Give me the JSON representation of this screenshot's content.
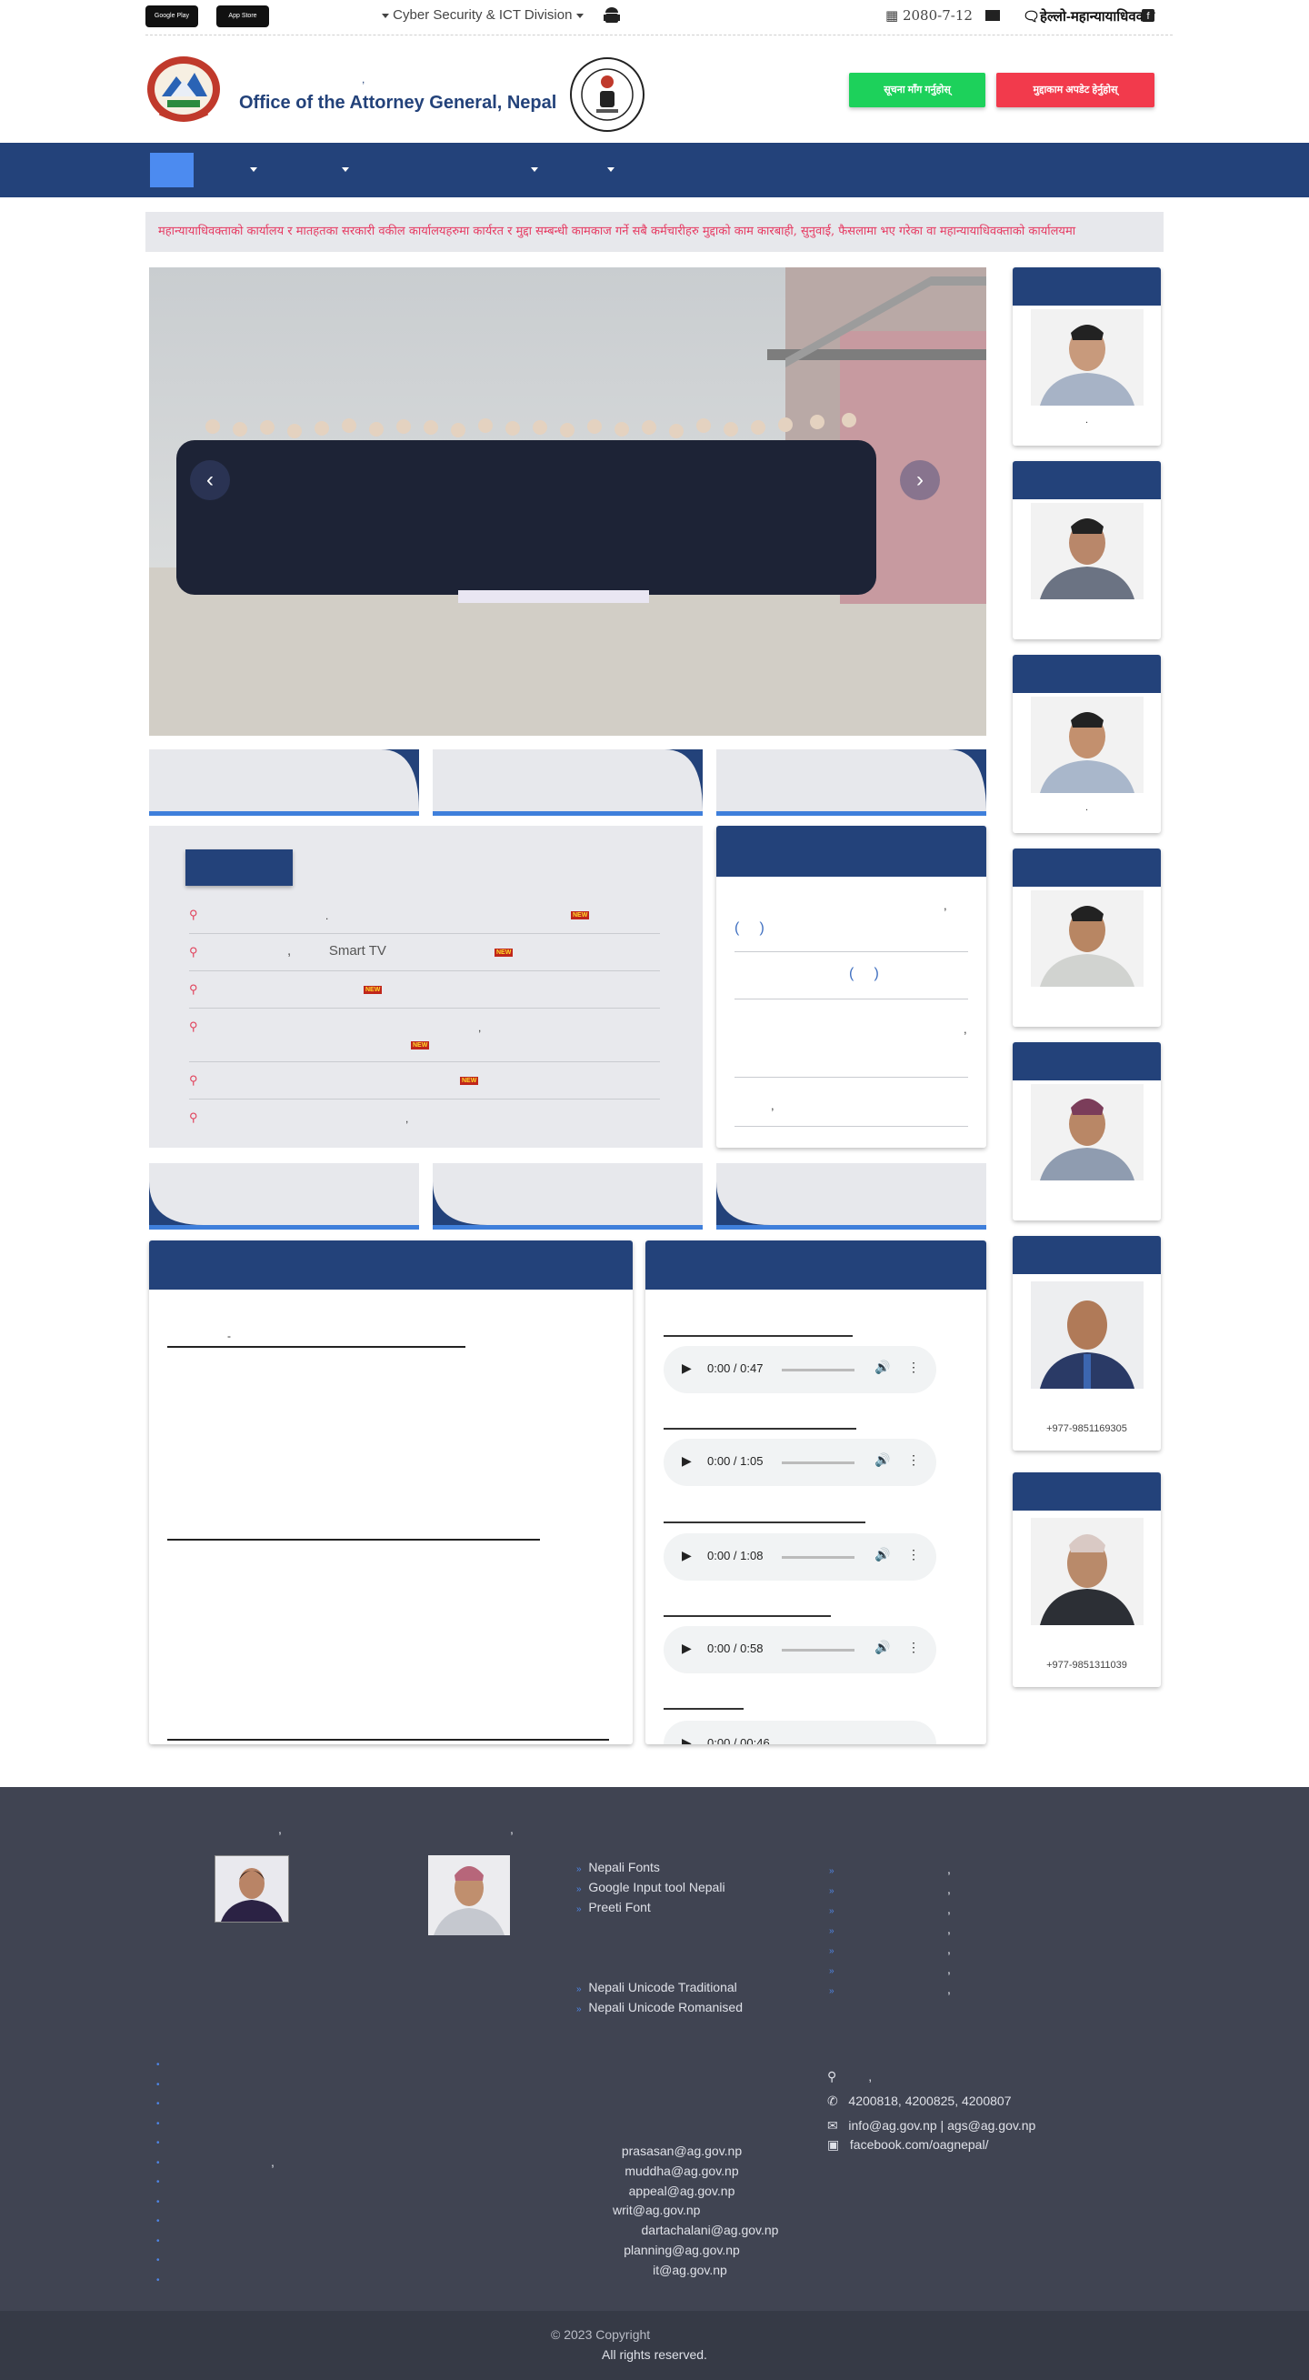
{
  "topbar": {
    "google_play": "Google Play",
    "app_store": "App Store",
    "division_dropdown": "Cyber Security & ICT Division",
    "date": "2080-7-12",
    "hotline": "हेल्लो-महान्यायाधिवक्ता"
  },
  "header": {
    "title_small": ",",
    "title_en": "Office of the Attorney General, Nepal",
    "btn_green": "सूचना माँग गर्नुहोस्",
    "btn_red": "मुद्दाकाम अपडेट हेर्नुहोस्"
  },
  "ticker": "महान्यायाधिवक्ताको कार्यालय र मातहतका सरकारी वकील कार्यालयहरुमा कार्यरत र मुद्दा सम्बन्धी कामकाज गर्ने सबै कर्मचारीहरु मुद्दाको काम कारबाही, सुनुवाई, फैसलामा भए गरेका वा महान्यायाधिवक्ताको कार्यालयमा",
  "news": [
    {
      "text": ".",
      "new": "NEW"
    },
    {
      "text": ",          Smart TV",
      "new": "NEW"
    },
    {
      "text": "",
      "new": "NEW"
    },
    {
      "text": ",",
      "new": "NEW"
    },
    {
      "text": "",
      "new": "NEW"
    },
    {
      "text": ",",
      "new": ""
    }
  ],
  "notice": {
    "row1": ",",
    "row1b": "(     )",
    "row2": "(     )",
    "row3": ",",
    "row4": ","
  },
  "left_panel": {
    "row1_dash": "-"
  },
  "audio": [
    {
      "time": "0:00 / 0:47"
    },
    {
      "time": "0:00 / 1:05"
    },
    {
      "time": "0:00 / 1:08"
    },
    {
      "time": "0:00 / 0:58"
    },
    {
      "time": "0:00 / 00:46"
    }
  ],
  "officials": [
    {
      "caption": "."
    },
    {
      "caption": ""
    },
    {
      "caption": "."
    },
    {
      "caption": ""
    },
    {
      "caption": ""
    },
    {
      "caption": "+977-9851169305"
    },
    {
      "caption": "+977-9851311039"
    }
  ],
  "footer": {
    "fonts": [
      "Nepali Fonts",
      "Google Input tool Nepali",
      "Preeti Font"
    ],
    "unicode": [
      "Nepali Unicode Traditional",
      "Nepali Unicode Romanised"
    ],
    "right_list": [
      ",",
      ",",
      ",",
      ",",
      ",",
      ",",
      ","
    ],
    "emails": [
      "prasasan@ag.gov.np",
      "muddha@ag.gov.np",
      "appeal@ag.gov.np",
      "writ@ag.gov.np",
      "dartachalani@ag.gov.np",
      "planning@ag.gov.np",
      "it@ag.gov.np"
    ],
    "address": ",",
    "phone": "4200818, 4200825, 4200807",
    "email": "info@ag.gov.np | ags@ag.gov.np",
    "facebook": "facebook.com/oagnepal/",
    "copyright": "© 2023 Copyright",
    "rights": "All rights reserved."
  },
  "colors": {
    "primary": "#23427a",
    "accent_blue": "#3f7fdb",
    "green": "#1dd15b",
    "red": "#f23a4c",
    "footer": "#404452"
  }
}
